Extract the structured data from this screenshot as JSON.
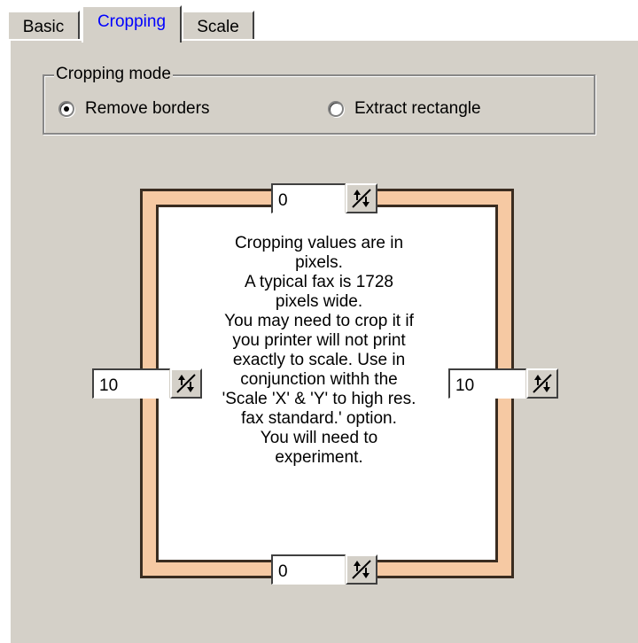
{
  "tabs": [
    {
      "label": "Basic"
    },
    {
      "label": "Cropping"
    },
    {
      "label": "Scale"
    }
  ],
  "cropping_mode": {
    "title": "Cropping mode",
    "options": [
      {
        "label": "Remove borders",
        "selected": true
      },
      {
        "label": "Extract rectangle",
        "selected": false
      }
    ]
  },
  "values": {
    "top": "0",
    "left": "10",
    "right": "10",
    "bottom": "0"
  },
  "info_lines": [
    "Cropping values are in",
    "pixels.",
    "A typical fax is 1728",
    "pixels wide.",
    "You may need to crop it if",
    "you printer will not print",
    "exactly to scale. Use in",
    "conjunction withh the",
    "'Scale 'X' & 'Y' to high res.",
    "fax standard.' option.",
    "You will need to",
    "experiment."
  ],
  "colors": {
    "panel": "#d4d0c8",
    "frame": "#f6c9a3",
    "active_tab_text": "#0000ff"
  }
}
